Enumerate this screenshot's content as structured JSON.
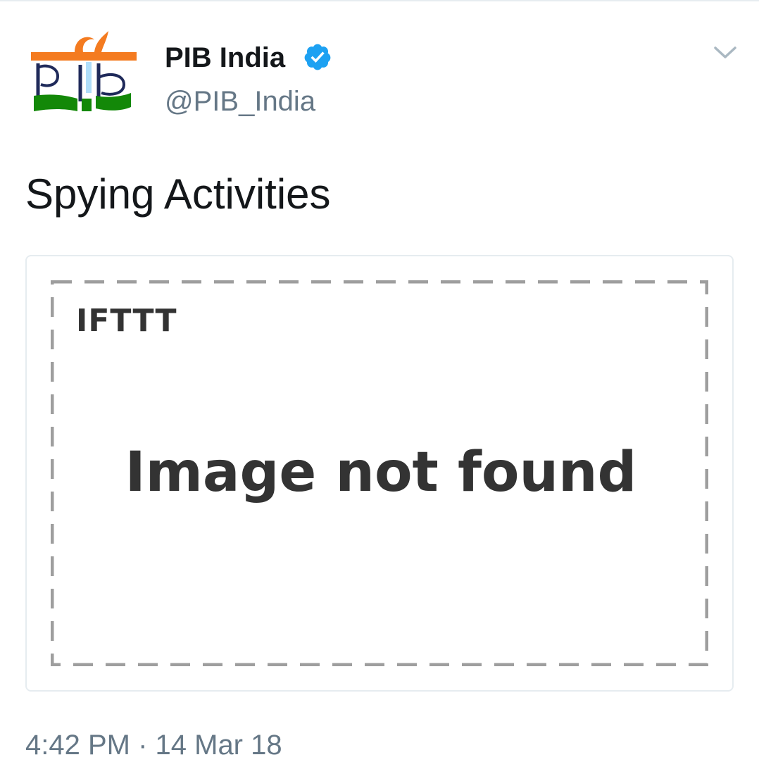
{
  "tweet": {
    "author": {
      "display_name": "PIB India",
      "handle": "@PIB_India",
      "verified_icon": "verified-badge-icon",
      "avatar_logo_text": "pib"
    },
    "text": "Spying Activities",
    "menu_icon": "chevron-down-icon",
    "card": {
      "brand": "IFTTT",
      "message": "Image not found"
    },
    "timestamp": "4:42 PM · 14 Mar 18"
  },
  "colors": {
    "text_primary": "#14171a",
    "text_secondary": "#657786",
    "verified_blue": "#1da1f2",
    "divider": "#e6ecf0",
    "logo_orange": "#f47b20",
    "logo_green": "#138808",
    "logo_navy": "#1f2a5a",
    "card_dash": "#9e9e9e",
    "card_text": "#333333"
  }
}
